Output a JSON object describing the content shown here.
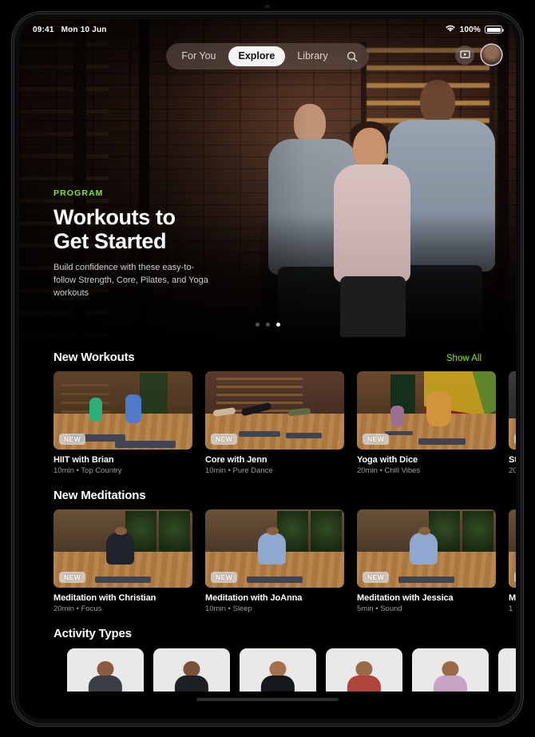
{
  "status_bar": {
    "time": "09:41",
    "date": "Mon 10 Jun",
    "battery_percent": "100%",
    "wifi_icon": "wifi-icon",
    "battery_icon": "battery-icon"
  },
  "nav": {
    "tabs": [
      {
        "label": "For You",
        "active": false
      },
      {
        "label": "Explore",
        "active": true
      },
      {
        "label": "Library",
        "active": false
      }
    ],
    "search_icon": "search-icon",
    "airplay_icon": "airplay-video-icon",
    "avatar": "user-avatar"
  },
  "hero": {
    "eyebrow": "PROGRAM",
    "eyebrow_color": "#8CE711",
    "title_line1": "Workouts to",
    "title_line2": "Get Started",
    "description": "Build confidence with these easy-to-follow Strength, Core, Pilates, and Yoga workouts",
    "page_dots": 3,
    "active_dot": 3
  },
  "sections": [
    {
      "title": "New Workouts",
      "show_all": "Show All",
      "show_all_color": "#8CE711",
      "items": [
        {
          "title": "HIIT with Brian",
          "subtitle": "10min • Top Country",
          "badge": "NEW",
          "scene": "sc-hiit"
        },
        {
          "title": "Core with Jenn",
          "subtitle": "10min • Pure Dance",
          "badge": "NEW",
          "scene": "sc-core"
        },
        {
          "title": "Yoga with Dice",
          "subtitle": "20min • Chill Vibes",
          "badge": "NEW",
          "scene": "sc-yoga"
        },
        {
          "title": "St",
          "subtitle": "20",
          "badge": "N",
          "scene": "sc-strength"
        }
      ]
    },
    {
      "title": "New Meditations",
      "show_all": "",
      "items": [
        {
          "title": "Meditation with Christian",
          "subtitle": "20min • Focus",
          "badge": "NEW",
          "scene": "sc-med"
        },
        {
          "title": "Meditation with JoAnna",
          "subtitle": "10min • Sleep",
          "badge": "NEW",
          "scene": "sc-med"
        },
        {
          "title": "Meditation with Jessica",
          "subtitle": "5min • Sound",
          "badge": "NEW",
          "scene": "sc-med"
        },
        {
          "title": "M",
          "subtitle": "1",
          "badge": "N",
          "scene": "sc-med"
        }
      ]
    },
    {
      "title": "Activity Types",
      "show_all": "",
      "items": [
        {
          "shirt": "#3a3f46",
          "pants": "#2a2f34",
          "skin": "#8a5c3e"
        },
        {
          "shirt": "#1d2126",
          "pants": "#1f9d6b",
          "skin": "#7a5237"
        },
        {
          "shirt": "#14171b",
          "pants": "#c4232a",
          "skin": "#a5704c"
        },
        {
          "shirt": "#b0453c",
          "pants": "#8d3a31",
          "skin": "#9c6a47"
        },
        {
          "shirt": "#c9a3c6",
          "pants": "#23262b",
          "skin": "#9a6a48"
        },
        {
          "shirt": "#4a4f56",
          "pants": "#2a2e33",
          "skin": "#8a5c3e"
        }
      ]
    }
  ]
}
